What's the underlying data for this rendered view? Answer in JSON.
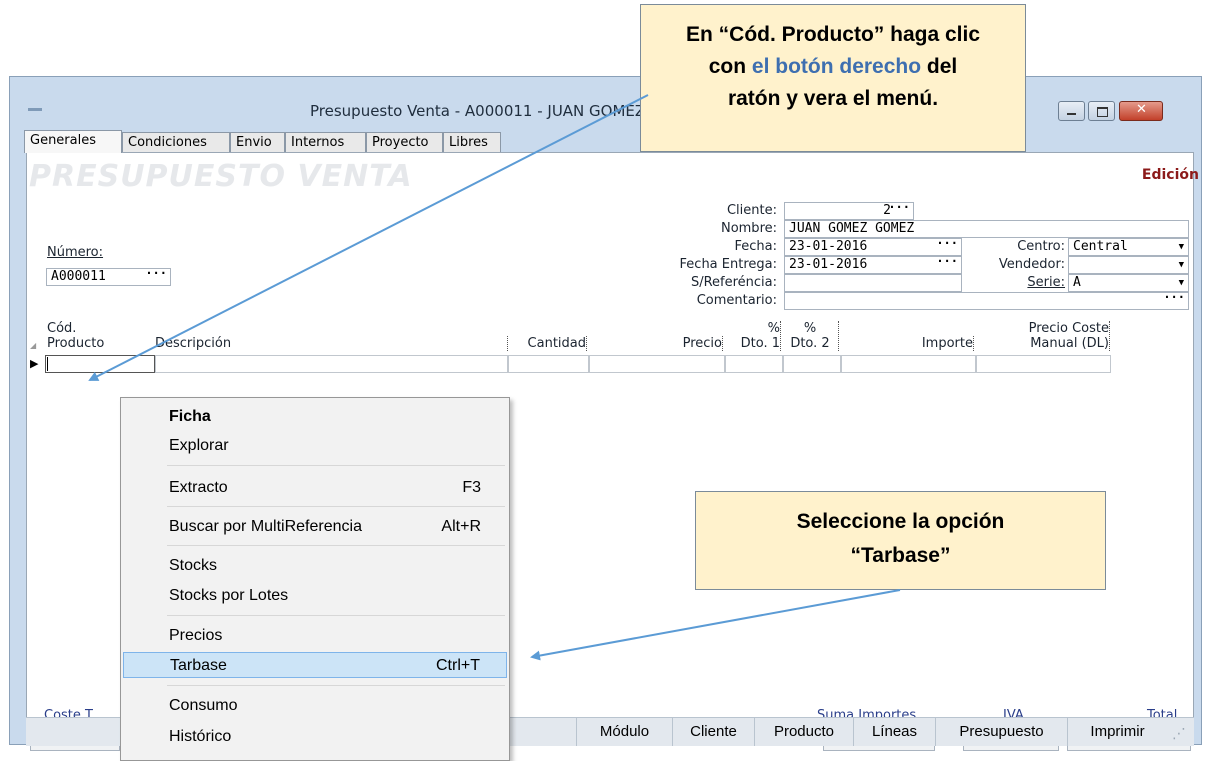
{
  "window": {
    "title": "Presupuesto Venta - A000011 - JUAN GOMEZ GOMEZ",
    "tabs": [
      "Generales",
      "Condiciones",
      "Envio",
      "Internos",
      "Proyecto",
      "Libres"
    ],
    "watermark": "PRESUPUESTO VENTA",
    "mode": "Edición"
  },
  "form": {
    "numero_label": "Número:",
    "numero_value": "A000011",
    "cliente_label": "Cliente:",
    "cliente_value": "2",
    "nombre_label": "Nombre:",
    "nombre_value": "JUAN GOMEZ GOMEZ",
    "fecha_label": "Fecha:",
    "fecha_value": "23-01-2016",
    "fecha_entrega_label": "Fecha Entrega:",
    "fecha_entrega_value": "23-01-2016",
    "sreferencia_label": "S/Referéncia:",
    "sreferencia_value": "",
    "comentario_label": "Comentario:",
    "comentario_value": "",
    "centro_label": "Centro:",
    "centro_value": "Central",
    "vendedor_label": "Vendedor:",
    "vendedor_value": "",
    "serie_label": "Serie:",
    "serie_value": "A"
  },
  "grid": {
    "columns": [
      "Cód.\nProducto",
      "Descripción",
      "Cantidad",
      "Precio",
      "%\nDto. 1",
      "%\nDto. 2",
      "Importe",
      "Precio Coste\nManual (DL)"
    ]
  },
  "context_menu": {
    "items": [
      {
        "label": "Ficha",
        "shortcut": ""
      },
      {
        "label": "Explorar",
        "shortcut": ""
      },
      {
        "label": "Extracto",
        "shortcut": "F3"
      },
      {
        "label": "Buscar por MultiReferencia",
        "shortcut": "Alt+R"
      },
      {
        "label": "Stocks",
        "shortcut": ""
      },
      {
        "label": "Stocks por Lotes",
        "shortcut": ""
      },
      {
        "label": "Precios",
        "shortcut": ""
      },
      {
        "label": "Tarbase",
        "shortcut": "Ctrl+T"
      },
      {
        "label": "Consumo",
        "shortcut": ""
      },
      {
        "label": "Histórico",
        "shortcut": ""
      }
    ]
  },
  "totals": {
    "coste_label": "Coste T",
    "suma_label": "Suma Importes",
    "iva_label": "IVA",
    "total_label": "Total"
  },
  "statusbar": [
    "Módulo",
    "Cliente",
    "Producto",
    "Líneas",
    "Presupuesto",
    "Imprimir"
  ],
  "callouts": {
    "top_line1_a": "En “Cód. Producto” haga clic",
    "top_line2_a": "con ",
    "top_line2_b": "el botón derecho",
    "top_line2_c": " del",
    "top_line3": "ratón y vera el menú.",
    "bottom_line1": "Seleccione la opción",
    "bottom_line2": "“Tarbase”"
  },
  "colors": {
    "callout_bg": "#fff2cc",
    "arrow": "#5b9bd5",
    "highlight": "#cce4f7"
  }
}
